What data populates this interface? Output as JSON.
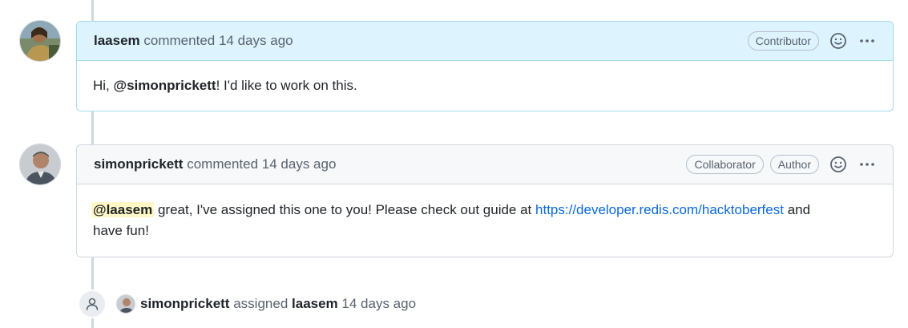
{
  "comments": [
    {
      "author": "laasem",
      "action": "commented",
      "time": "14 days ago",
      "badges": [
        "Contributor"
      ],
      "body": {
        "prefix": "Hi, ",
        "mention": "@simonprickett",
        "suffix": "! I'd like to work on this."
      }
    },
    {
      "author": "simonprickett",
      "action": "commented",
      "time": "14 days ago",
      "badges": [
        "Collaborator",
        "Author"
      ],
      "body": {
        "mention": "@laasem",
        "text1": " great, I've assigned this one to you! Please check out guide at ",
        "link": "https://developer.redis.com/hacktoberfest",
        "text2": " and have fun!"
      }
    }
  ],
  "event": {
    "actor": "simonprickett",
    "action": "assigned",
    "target": "laasem",
    "time": "14 days ago"
  },
  "icons": {
    "emoji": "smiley-icon",
    "more": "kebab-horizontal-icon",
    "person": "person-icon"
  },
  "colors": {
    "highlight_header": "#ddf4ff",
    "header": "#f6f8fa",
    "link": "#0969da",
    "mention_highlight": "#fff8c5"
  }
}
